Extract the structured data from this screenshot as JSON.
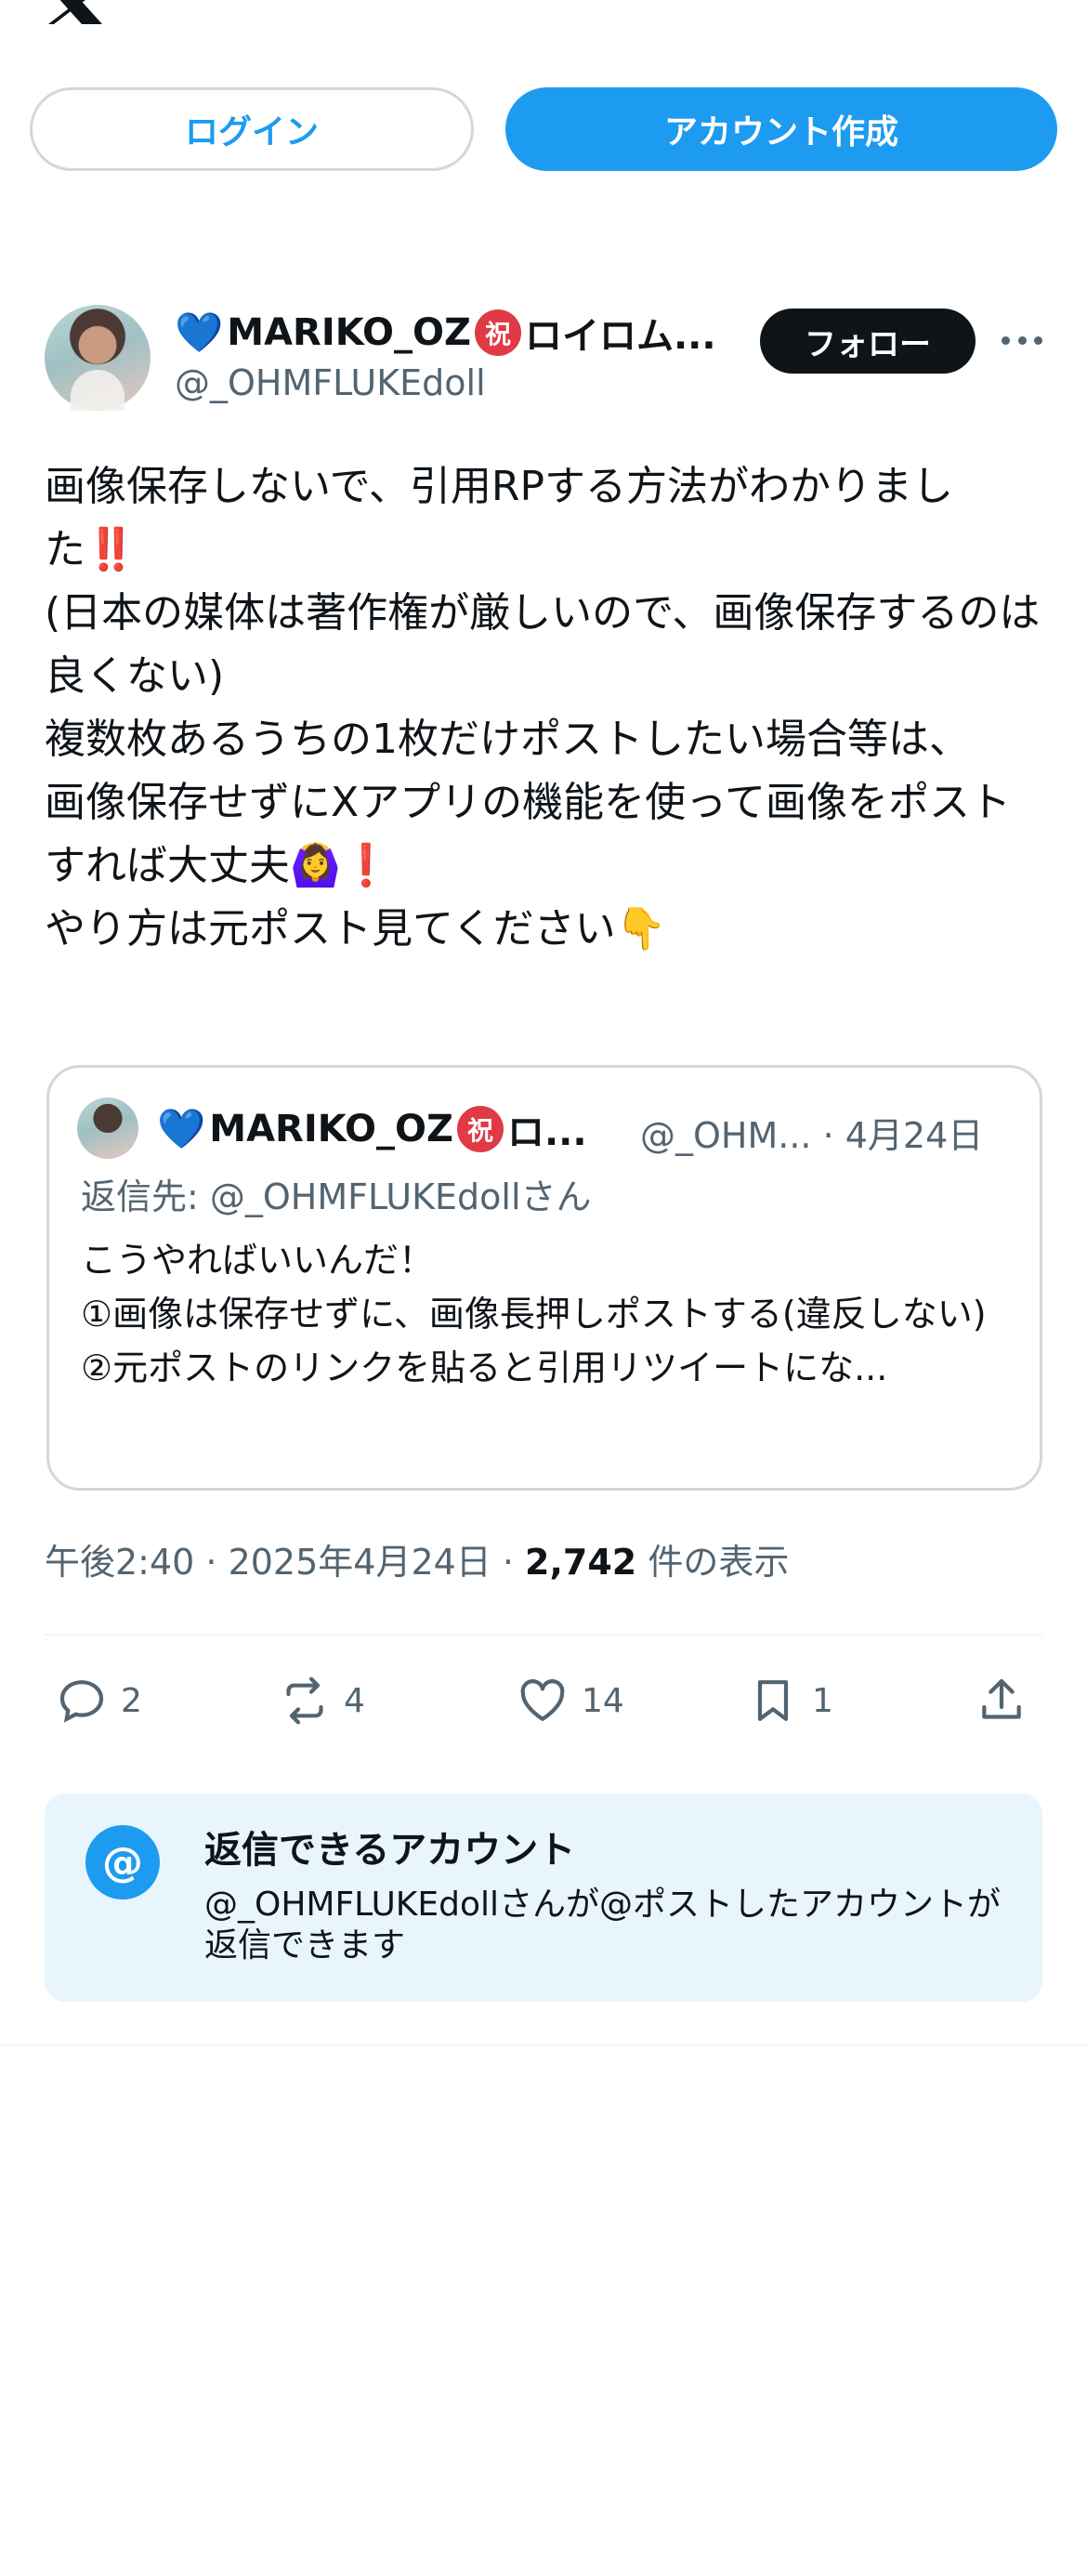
{
  "header": {
    "logo_icon": "x-logo-icon"
  },
  "auth": {
    "login_label": "ログイン",
    "signup_label": "アカウント作成"
  },
  "post": {
    "author_name": "MARIKO_OZ",
    "author_name_tail": "ロイロム...",
    "author_badge": "祝",
    "author_handle": "@_OHMFLUKEdoll",
    "follow_label": "フォロー",
    "text": "画像保存しないで、引用RPする方法がわかりました‼️\n(日本の媒体は著作権が厳しいので、画像保存するのは良くない)\n複数枚あるうちの1枚だけポストしたい場合等は、\n画像保存せずにXアプリの機能を使って画像をポストすれば大丈夫🙆‍♀️❗️\nやり方は元ポスト見てください👇"
  },
  "quote": {
    "author_name": "MARIKO_OZ",
    "author_name_tail": "ロ...",
    "author_badge": "祝",
    "meta": "@_OHM... · 4月24日",
    "reply_to": "返信先: @_OHMFLUKEdollさん",
    "text": "こうやればいいんだ！\n①画像は保存せずに、画像長押しポストする(違反しない)\n②元ポストのリンクを貼ると引用リツイートにな..."
  },
  "timestamp": {
    "time": "午後2:40 · 2025年4月24日 · ",
    "views": "2,742",
    "views_label": " 件の表示"
  },
  "actions": {
    "replies": "2",
    "reposts": "4",
    "likes": "14",
    "bookmarks": "1"
  },
  "reply_restriction": {
    "title": "返信できるアカウント",
    "description": "@_OHMFLUKEdollさんが@ポストしたアカウントが返信できます"
  },
  "colors": {
    "accent": "#1d9bf0",
    "text": "#0f1419",
    "muted": "#536471",
    "badge": "#e03a45",
    "heart": "#5dadec"
  }
}
